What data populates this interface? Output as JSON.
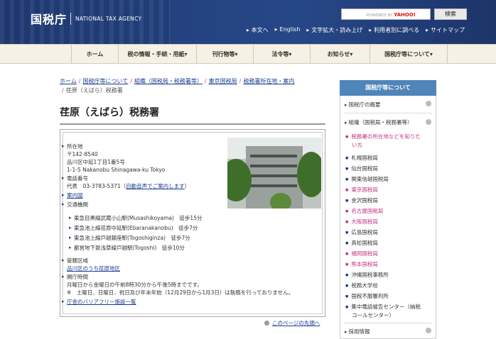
{
  "header": {
    "logo": "国税庁",
    "logo_en": "NATIONAL TAX AGENCY",
    "search_placeholder": "",
    "search_powered": "POWERED BY",
    "search_brand": "YAHOO!",
    "search_button": "検索",
    "util_links": [
      "本文へ",
      "English",
      "文字拡大・読み上げ",
      "利用者別に調べる",
      "サイトマップ"
    ]
  },
  "nav": [
    "ホーム",
    "税の情報・手続・用紙▾",
    "刊行物等▾",
    "法令等▾",
    "お知らせ▾",
    "国税庁等について▾"
  ],
  "breadcrumb": [
    "ホーム",
    "国税庁等について",
    "組織（国税局・税務署等）",
    "東京国税局",
    "税務署所在地・案内",
    "荏原（えばら）税務署"
  ],
  "title": "荏原（えばら）税務署",
  "info": {
    "loc_label": "所在地",
    "postal": "〒142-8540",
    "addr1": "品川区中延1丁目1番5号",
    "addr2": "1-1-5 Nakanobu Shinagawa-ku Tokyo",
    "tel_label": "電話番号",
    "tel_prefix": "代表　03-3783-5371（",
    "tel_link": "自動音声でご案内します",
    "tel_suffix": "）",
    "map_link": "案内図",
    "transit_label": "交通機関",
    "transit": [
      "東急目黒線武蔵小山駅(Musashikoyama)　徒歩15分",
      "東急池上線荏原中延駅(Ebaranakanobu)　徒歩7分",
      "東急池上線戸越銀座駅(Togoshiginza)　徒歩7分",
      "都営地下鉄浅草線戸越駅(Togoshi)　徒歩10分"
    ],
    "area_label": "管轄区域",
    "area_link": "品川区のうち荏原地区",
    "hours_label": "開庁時間",
    "hours1": "月曜日から金曜日の午前8時30分から午後5時までです。",
    "hours2": "※　土曜日、日曜日、祝日及び年末年始（12月29日から1月3日）は執務を行っておりません。",
    "barrier_link": "庁舎のバリアフリー施設一覧"
  },
  "top_link": "このページの先頭へ",
  "sidebar": {
    "title": "国税庁等について",
    "sec1": "国税庁の概要",
    "sec2": "組織（国税局・税務署等）",
    "items": [
      "税務署の所在地などを知りた",
      "い方",
      "札幌国税局",
      "仙台国税局",
      "関東信越国税局",
      "東京国税局",
      "金沢国税局",
      "名古屋国税局",
      "大阪国税局",
      "広島国税局",
      "高松国税局",
      "福岡国税局",
      "熊本国税局",
      "沖縄国税事務所",
      "税務大学校",
      "国税不服審判所",
      "集中電話催告センター（納税",
      "コールセンター）"
    ],
    "sec3": "採用情報"
  }
}
